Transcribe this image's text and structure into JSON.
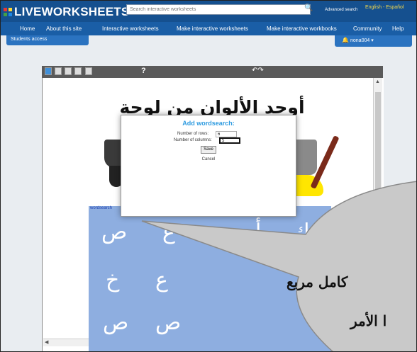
{
  "header": {
    "logo_text": "LIVEWORKSHEETS",
    "search_placeholder": "Search interactive worksheets",
    "advanced_search": "Advanced search",
    "language_links": "English - Español"
  },
  "nav": {
    "items": [
      "Home",
      "About this site",
      "Interactive worksheets",
      "Make interactive worksheets",
      "Make interactive workbooks",
      "Community",
      "Help"
    ],
    "students_access": "Students access",
    "username": "nona004"
  },
  "worksheet": {
    "toolbar_help": "?",
    "title": "أوجد الألوان من لوحة الحروف",
    "wordsearch_label": "wordsearch",
    "rows": [
      [
        "ك",
        "أ",
        "ب",
        "ع",
        "ص"
      ],
      [
        "",
        "",
        "",
        "ع",
        "خ"
      ],
      [
        "",
        "",
        "",
        "ص",
        "ص"
      ]
    ]
  },
  "dialog": {
    "title": "Add wordsearch:",
    "rows_label": "Number of rows:",
    "rows_value": "6",
    "columns_label": "Number of columns:",
    "columns_value": "5",
    "save_label": "Save",
    "cancel_label": "Cancel"
  },
  "bubble": {
    "line1": "كامل مربع",
    "line2": "ا الأمر"
  },
  "colors": {
    "topbar": "#15508f",
    "nav": "#1a5ea6",
    "wordsearch_bg": "#8eaee0",
    "dialog_title": "#2e9be0"
  }
}
